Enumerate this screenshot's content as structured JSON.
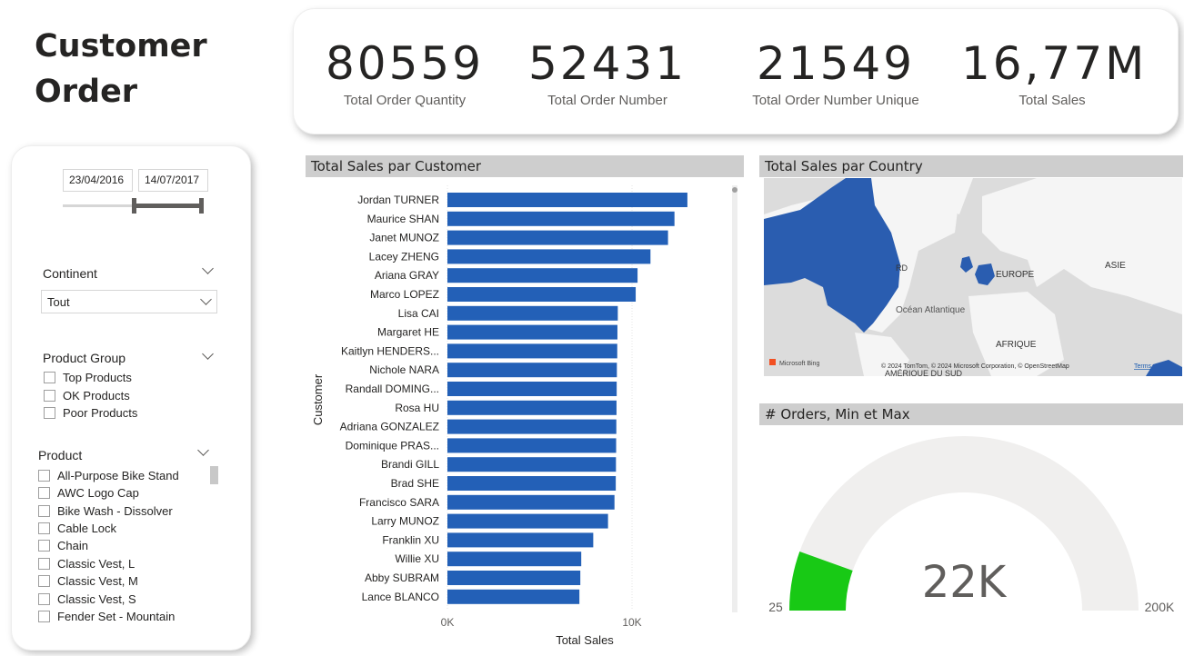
{
  "page_title": "Customer Order",
  "kpis": [
    {
      "value": "80559",
      "label": "Total Order Quantity"
    },
    {
      "value": "52431",
      "label": "Total Order Number"
    },
    {
      "value": "21549",
      "label": "Total Order Number Unique"
    },
    {
      "value": "16,77M",
      "label": "Total Sales"
    }
  ],
  "filters": {
    "date_start": "23/04/2016",
    "date_end": "14/07/2017",
    "continent": {
      "title": "Continent",
      "selected": "Tout"
    },
    "product_group": {
      "title": "Product Group",
      "items": [
        "Top Products",
        "OK Products",
        "Poor Products"
      ]
    },
    "product": {
      "title": "Product",
      "items": [
        "All-Purpose Bike Stand",
        "AWC Logo Cap",
        "Bike Wash - Dissolver",
        "Cable Lock",
        "Chain",
        "Classic Vest, L",
        "Classic Vest, M",
        "Classic Vest, S",
        "Fender Set - Mountain"
      ]
    }
  },
  "colors": {
    "bar": "#2360b7",
    "gauge_fill": "#18c915",
    "gauge_track": "#f0efee",
    "header_bg": "#cecece",
    "map_land": "#f5f5f5",
    "map_sea": "#dcdcdc",
    "map_highlight": "#2a5db0"
  },
  "map": {
    "title": "Total Sales par Country",
    "labels": {
      "europe": "EUROPE",
      "asie": "ASIE",
      "ocean": "Océan Atlantique",
      "afrique": "AFRIQUE",
      "amerique_sud": "AMÉRIQUE DU SUD",
      "rd": "RD"
    },
    "attribution": "© 2024 TomTom, © 2024 Microsoft Corporation, © OpenStreetMap",
    "terms": "Terms",
    "logo": "Microsoft Bing"
  },
  "gauge": {
    "title": "# Orders, Min et Max",
    "min_label": "25",
    "max_label": "200K",
    "value_label": "22K",
    "min": 25,
    "max": 200000,
    "value": 22000
  },
  "chart_data": {
    "type": "bar",
    "orientation": "horizontal",
    "title": "Total Sales par Customer",
    "xlabel": "Total Sales",
    "ylabel": "Customer",
    "xlim": [
      0,
      15000
    ],
    "xticks": [
      "0K",
      "10K"
    ],
    "xtick_values": [
      0,
      10000
    ],
    "categories": [
      "Jordan TURNER",
      "Maurice SHAN",
      "Janet MUNOZ",
      "Lacey ZHENG",
      "Ariana GRAY",
      "Marco LOPEZ",
      "Lisa CAI",
      "Margaret HE",
      "Kaitlyn HENDERS...",
      "Nichole NARA",
      "Randall DOMING...",
      "Rosa HU",
      "Adriana GONZALEZ",
      "Dominique PRAS...",
      "Brandi GILL",
      "Brad SHE",
      "Francisco SARA",
      "Larry MUNOZ",
      "Franklin XU",
      "Willie XU",
      "Abby SUBRAM",
      "Lance BLANCO"
    ],
    "values": [
      13000,
      12300,
      11950,
      11000,
      10300,
      10200,
      9230,
      9210,
      9200,
      9180,
      9170,
      9160,
      9150,
      9140,
      9130,
      9120,
      9050,
      8700,
      7900,
      7250,
      7200,
      7150
    ]
  }
}
